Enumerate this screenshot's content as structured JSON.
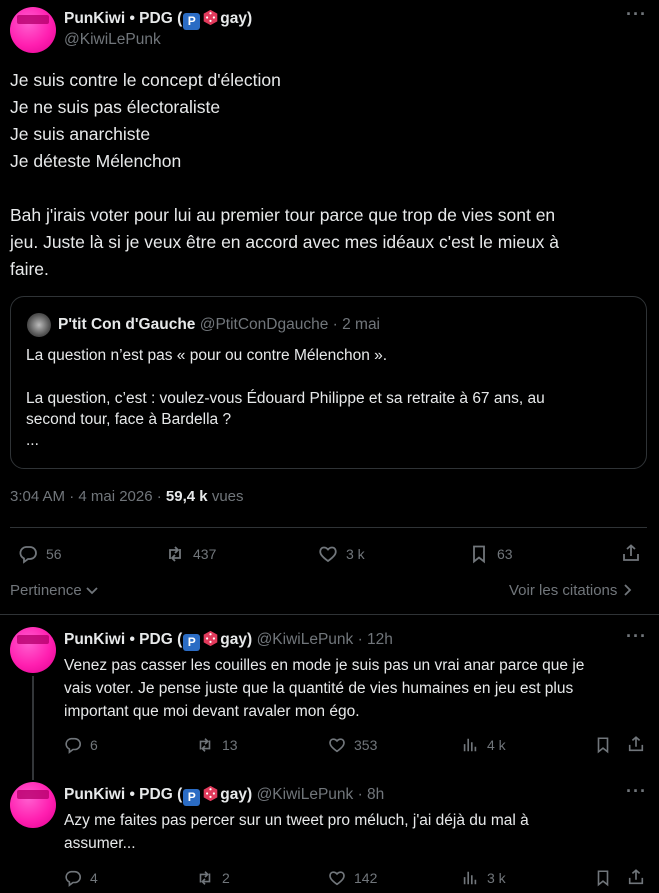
{
  "main": {
    "author_name": "PunKiwi • PDG (",
    "author_badge_p": "P",
    "author_name_tail": "gay)",
    "author_handle": "@KiwiLePunk",
    "text_lines": [
      "Je suis contre le concept d'élection",
      "Je ne suis pas électoraliste",
      "Je suis anarchiste",
      "Je déteste Mélenchon"
    ],
    "text_para": [
      "Bah j'irais voter pour lui au premier tour parce que trop de vies sont en",
      "jeu. Juste là si je veux être en accord avec mes idéaux c'est le mieux à",
      "faire."
    ],
    "quote": {
      "name": "P'tit Con d'Gauche",
      "handle_date": "@PtitConDgauche · 2 mai",
      "line1": "La question n’est pas « pour ou contre Mélenchon ».",
      "line2": "La question, c’est : voulez-vous Édouard Philippe et sa retraite à 67 ans, au",
      "line3": "second tour, face à Bardella ?",
      "line4": "..."
    },
    "timestamp": "3:04 AM · 4 mai 2026 ·",
    "views_value": "59,4 k",
    "views_label": "vues",
    "actions": {
      "replies": "56",
      "retweets": "437",
      "likes": "3 k",
      "bookmarks": "63"
    },
    "sort_label": "Pertinence",
    "quotes_link": "Voir les citations"
  },
  "replies": [
    {
      "name": "PunKiwi • PDG (",
      "badge_p": "P",
      "name_tail": "gay)",
      "handle_time": "@KiwiLePunk · 12h",
      "lines": [
        "Venez pas casser les couilles en mode je suis pas un vrai anar parce que je",
        "vais voter. Je pense juste que la quantité de vies humaines en jeu est plus",
        "important que moi devant ravaler mon égo."
      ],
      "replies": "6",
      "retweets": "13",
      "likes": "353",
      "views": "4 k"
    },
    {
      "name": "PunKiwi • PDG (",
      "badge_p": "P",
      "name_tail": "gay)",
      "handle_time": "@KiwiLePunk · 8h",
      "lines": [
        "Azy me faites pas percer sur un tweet pro méluch, j'ai déjà du mal à",
        "assumer..."
      ],
      "replies": "4",
      "retweets": "2",
      "likes": "142",
      "views": "3 k"
    }
  ],
  "colors": {
    "background": "#000000",
    "text": "#e7e9ea",
    "muted": "#71767b",
    "border": "#2f3336",
    "avatar": "#ff1fb0"
  }
}
